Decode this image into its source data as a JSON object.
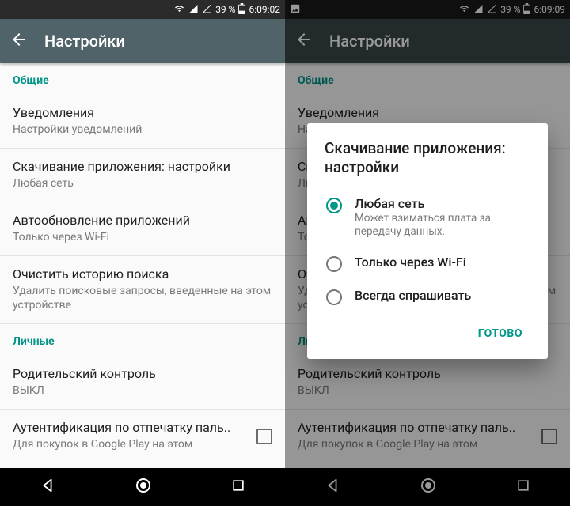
{
  "colors": {
    "accent": "#009688",
    "appbar": "#4f6368"
  },
  "status": {
    "battery_pct": "39 %",
    "time_left": "6:09:02",
    "time_right": "6:09:09"
  },
  "appbar": {
    "title": "Настройки"
  },
  "sections": {
    "general": "Общие",
    "personal": "Личные"
  },
  "items": {
    "notifications": {
      "title": "Уведомления",
      "sub": "Настройки уведомлений"
    },
    "download": {
      "title": "Скачивание приложения: настройки",
      "sub": "Любая сеть"
    },
    "autoupdate": {
      "title": "Автообновление приложений",
      "sub": "Только через Wi-Fi"
    },
    "clear_search": {
      "title": "Очистить историю поиска",
      "sub": "Удалить поисковые запросы, введенные на этом устройстве"
    },
    "parental": {
      "title": "Родительский контроль",
      "sub": "ВЫКЛ"
    },
    "fingerprint": {
      "title": "Аутентификация по отпечатку паль..",
      "sub": "Для покупок в Google Play на этом"
    }
  },
  "dialog": {
    "title": "Скачивание приложения: настройки",
    "options": [
      {
        "label": "Любая сеть",
        "sub": "Может взиматься плата за передачу данных.",
        "selected": true
      },
      {
        "label": "Только через Wi-Fi",
        "selected": false
      },
      {
        "label": "Всегда спрашивать",
        "selected": false
      }
    ],
    "done": "ГОТОВО"
  },
  "right_partial": {
    "notif_sub_cut": "На",
    "download_title_cut": "Ск",
    "download_sub_cut": "Лю",
    "autoupdate_title_cut": "Ав",
    "autoupdate_sub_cut": "То",
    "clear_title_cut": "Оч",
    "clear_sub_cut": "Уда\nуст",
    "personal_cut": "Ли"
  }
}
